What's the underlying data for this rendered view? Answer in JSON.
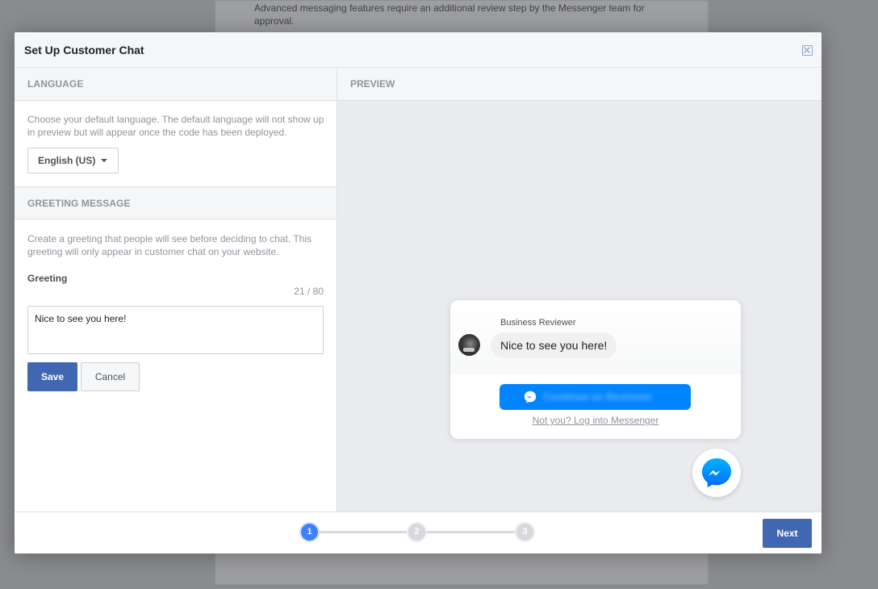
{
  "background": {
    "notice": "Advanced messaging features require an additional review step by the Messenger team for approval."
  },
  "modal": {
    "title": "Set Up Customer Chat",
    "close_icon": "close-icon"
  },
  "language": {
    "heading": "LANGUAGE",
    "help": "Choose your default language. The default language will not show up in preview but will appear once the code has been deployed.",
    "selected": "English (US)"
  },
  "greeting": {
    "heading": "GREETING MESSAGE",
    "help": "Create a greeting that people will see before deciding to chat. This greeting will only appear in customer chat on your website.",
    "label": "Greeting",
    "counter": "21 / 80",
    "value": "Nice to see you here!",
    "save_label": "Save",
    "cancel_label": "Cancel"
  },
  "preview": {
    "heading": "PREVIEW",
    "business_name": "Business Reviewer",
    "message": "Nice to see you here!",
    "continue_label": "Continue as Reviewer",
    "login_link": "Not you? Log into Messenger",
    "messenger_icon": "messenger-icon"
  },
  "footer": {
    "steps": [
      "1",
      "2",
      "3"
    ],
    "current_step": 1,
    "next_label": "Next"
  },
  "colors": {
    "primary": "#4267b2",
    "messenger_blue": "#0084ff",
    "step_active": "#4080ff"
  }
}
